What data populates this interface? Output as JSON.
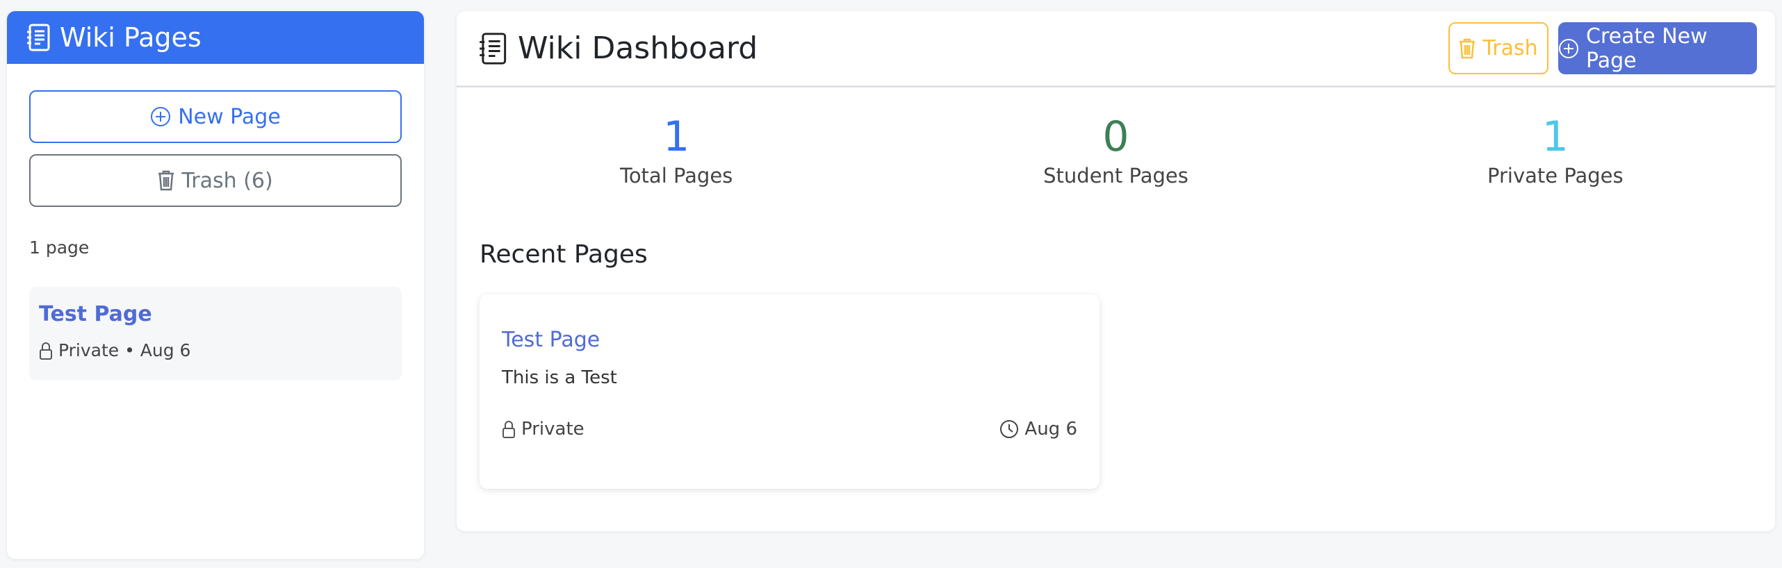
{
  "sidebar": {
    "title": "Wiki Pages",
    "new_page": "New Page",
    "trash": "Trash (6)",
    "count": "1 page",
    "items": [
      {
        "title": "Test Page",
        "meta": "Private • Aug 6"
      }
    ]
  },
  "main": {
    "title": "Wiki Dashboard",
    "trash": "Trash",
    "create": "Create New Page",
    "stats": [
      {
        "value": "1",
        "label": "Total Pages",
        "color": "#3570f0"
      },
      {
        "value": "0",
        "label": "Student Pages",
        "color": "#3e7f55"
      },
      {
        "value": "1",
        "label": "Private Pages",
        "color": "#4cc7ea"
      }
    ],
    "recent_title": "Recent Pages",
    "recent": [
      {
        "title": "Test Page",
        "desc": "This is a Test",
        "visibility": "Private",
        "date": "Aug 6"
      }
    ]
  }
}
